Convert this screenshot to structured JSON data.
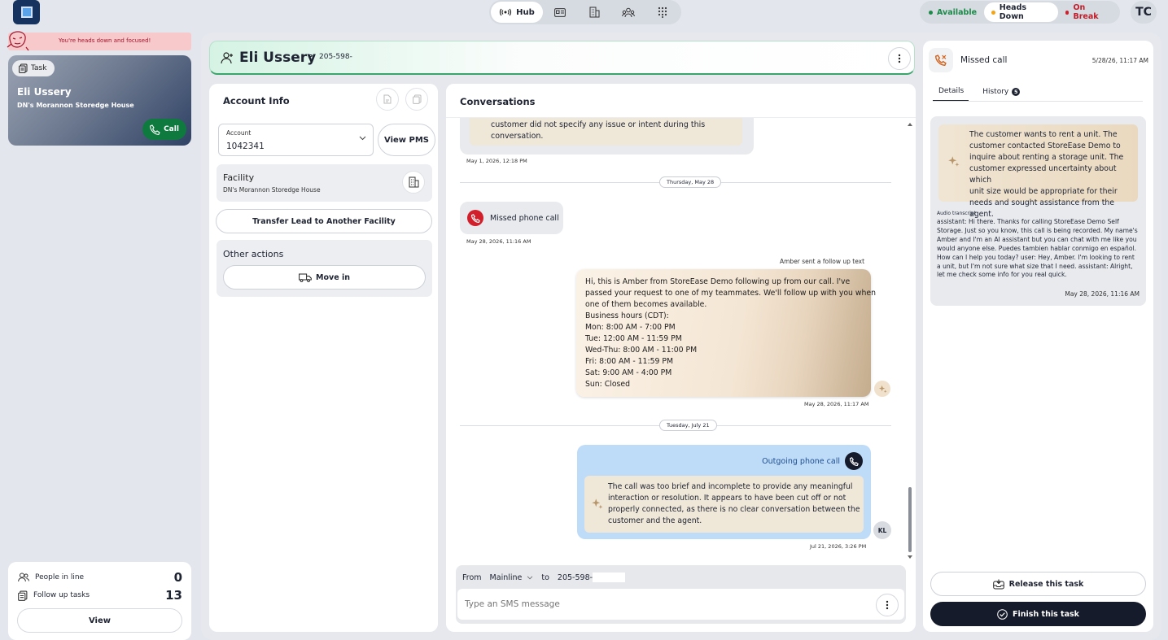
{
  "topbar": {
    "hub_label": "Hub",
    "status": {
      "available": "Available",
      "heads_down": "Heads Down",
      "on_break": "On Break",
      "available_color": "#1b8a48",
      "heads_down_color": "#f2a516",
      "on_break_color": "#d11f2b"
    },
    "user_initials": "TC"
  },
  "banner": {
    "text": "You're heads down and focused!"
  },
  "task_card": {
    "tag": "Task",
    "name": "Eli Ussery",
    "facility": "DN's Morannon Storedge House",
    "call_label": "Call"
  },
  "queue": {
    "people_in_line_label": "People in line",
    "people_in_line_count": "0",
    "follow_up_label": "Follow up tasks",
    "follow_up_count": "13",
    "view_label": "View"
  },
  "header": {
    "name": "Eli Ussery",
    "phone_type": "P",
    "phone": "205-598-"
  },
  "account_info": {
    "title": "Account Info",
    "account_label": "Account",
    "account_value": "1042341",
    "view_pms": "View PMS",
    "facility_label": "Facility",
    "facility_value": "DN's Morannon Storedge House",
    "transfer_label": "Transfer Lead to Another Facility",
    "other_actions": "Other actions",
    "move_in": "Move in"
  },
  "conversations": {
    "title": "Conversations",
    "old_summary_lines": [
      "customer did not specify any issue or intent during this",
      "conversation."
    ],
    "old_ts": "May 1, 2026, 12:18 PM",
    "divider1": "Thursday, May 28",
    "missed_call": "Missed phone call",
    "missed_ts": "May 28, 2026, 11:16 AM",
    "follow_up_label": "Amber sent a follow up text",
    "follow_up_lines": [
      "Hi, this is Amber from StoreEase Demo following up from our call. I've",
      "passed your request to one of my teammates. We'll follow up with you when",
      "one of them becomes available.",
      "Business hours (CDT):",
      "Mon: 8:00 AM - 7:00 PM",
      "Tue: 12:00 AM - 11:59 PM",
      "Wed-Thu: 8:00 AM - 11:00 PM",
      "Fri: 8:00 AM - 11:59 PM",
      "Sat: 9:00 AM - 4:00 PM",
      "Sun: Closed"
    ],
    "follow_up_ts": "May 28, 2026, 11:17 AM",
    "divider2": "Tuesday, July 21",
    "outgoing_label": "Outgoing phone call",
    "outgoing_lines": [
      "The call was too brief and incomplete to provide any meaningful",
      "interaction or resolution. It appears to have been cut off or not",
      "properly connected, as there is no clear conversation between the",
      "customer and the agent."
    ],
    "agent_initials": "KL",
    "outgoing_ts": "Jul 21, 2026, 3:26 PM",
    "from_label": "From",
    "from_value": "Mainline",
    "to_label": "to",
    "to_value": "205-598-",
    "sms_placeholder": "Type an SMS message"
  },
  "right_panel": {
    "title": "Missed call",
    "date": "5/28/26, 11:17 AM",
    "tab_details": "Details",
    "tab_history": "History",
    "history_count": "5",
    "summary_lines": [
      "The customer wants to rent a unit. The",
      "customer contacted StoreEase Demo to",
      "inquire about renting a storage unit. The",
      "customer expressed uncertainty about which",
      "unit size would be appropriate for their",
      "needs and sought assistance from the agent."
    ],
    "transcript_label": "Audio transcript",
    "transcript_lines": [
      "assistant: Hi there. Thanks for calling StoreEase Demo Self",
      "Storage. Just so you know, this call is being recorded. My name's",
      "Amber and I'm an AI assistant but you can chat with me like you",
      "would anyone else. Puedes tambien hablar conmigo en español.",
      "How can I help you today? user: Hey, Amber. I'm looking to rent",
      "a unit, but I'm not sure what size that I need. assistant: Alright,",
      "let me check some info for you real quick."
    ],
    "transcript_date": "May 28, 2026, 11:16 AM",
    "release_label": "Release this task",
    "finish_label": "Finish this task"
  }
}
